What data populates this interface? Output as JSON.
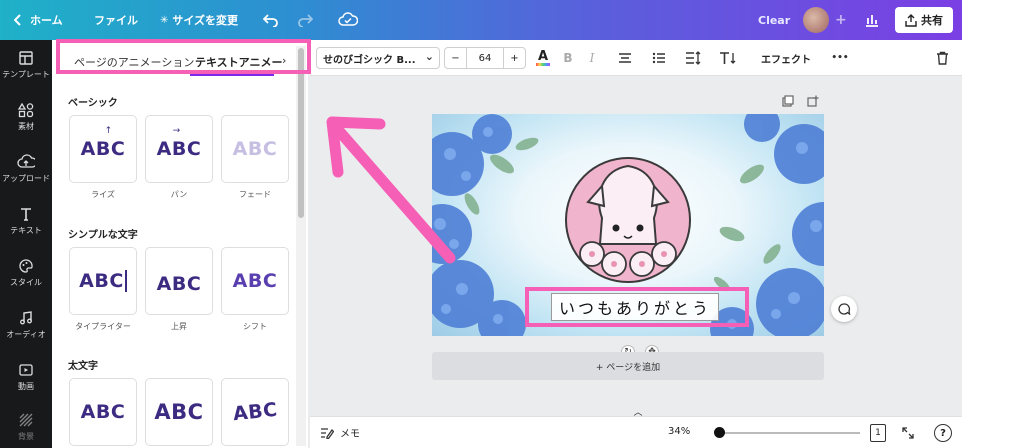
{
  "topbar": {
    "home_label": "ホーム",
    "file_label": "ファイル",
    "resize_label": "サイズを変更",
    "clear_label": "Clear",
    "share_label": "共有"
  },
  "rail": {
    "items": [
      {
        "label": "テンプレート",
        "icon": "template-icon"
      },
      {
        "label": "素材",
        "icon": "elements-icon"
      },
      {
        "label": "アップロード",
        "icon": "upload-icon"
      },
      {
        "label": "テキスト",
        "icon": "text-icon"
      },
      {
        "label": "スタイル",
        "icon": "palette-icon"
      },
      {
        "label": "オーディオ",
        "icon": "audio-icon"
      },
      {
        "label": "動画",
        "icon": "video-icon"
      },
      {
        "label": "背景",
        "icon": "background-icon"
      }
    ]
  },
  "panel": {
    "tabs": [
      {
        "label": "ページのアニメーション"
      },
      {
        "label": "テキストアニメー"
      }
    ],
    "sections": [
      {
        "title": "ベーシック",
        "cards": [
          {
            "preview": "ABC",
            "label": "ライズ",
            "mark": "↑"
          },
          {
            "preview": "ABC",
            "label": "パン",
            "mark": "→"
          },
          {
            "preview": "ABC",
            "label": "フェード",
            "mark": ""
          }
        ]
      },
      {
        "title": "シンプルな文字",
        "cards": [
          {
            "preview": "ABC",
            "label": "タイプライター",
            "mark": ""
          },
          {
            "preview": "ABC",
            "label": "上昇",
            "mark": ""
          },
          {
            "preview": "ABC",
            "label": "シフト",
            "mark": ""
          }
        ]
      },
      {
        "title": "太文字",
        "cards": [
          {
            "preview": "ABC",
            "label": "",
            "mark": ""
          },
          {
            "preview": "ABC",
            "label": "",
            "mark": ""
          },
          {
            "preview": "ABC",
            "label": "",
            "mark": ""
          }
        ]
      }
    ]
  },
  "toolbar": {
    "font_name": "せのびゴシック B...",
    "font_size": "64",
    "minus": "−",
    "plus": "+",
    "effects_label": "エフェクト",
    "more": "•••",
    "text_color": "#7d2ae8"
  },
  "canvas": {
    "caption": "いつもありがとう",
    "add_page_label": "+ ページを追加"
  },
  "bottombar": {
    "memo_label": "メモ",
    "zoom_label": "34%",
    "zoom_fraction": 0.0,
    "page_count": "1",
    "help": "?"
  },
  "colors": {
    "accent": "#7d2ae8",
    "annotation": "#f55fb5",
    "rail_bg": "#18191b"
  }
}
